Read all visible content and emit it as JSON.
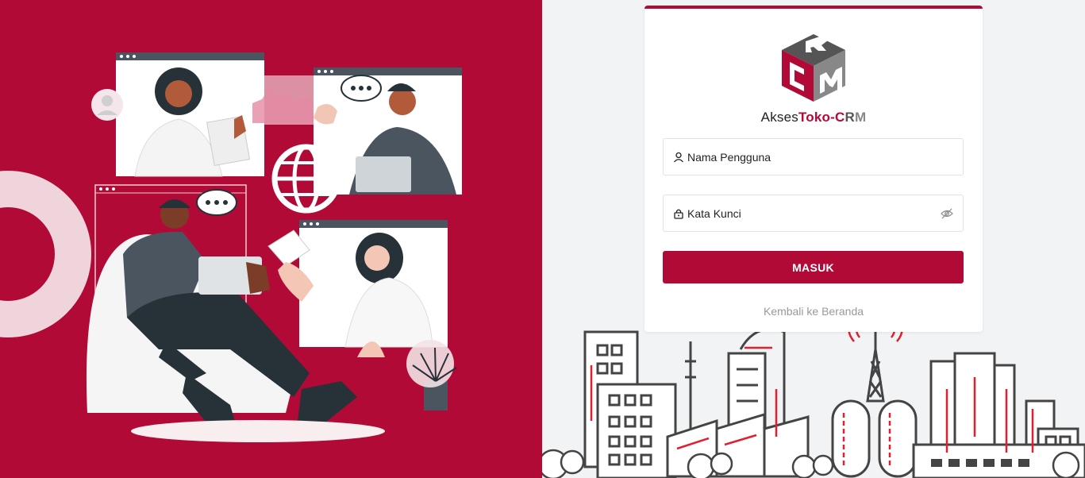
{
  "brand": {
    "prefix": "Akses",
    "toko": "Toko-",
    "c": "C",
    "r": "R",
    "m": "M"
  },
  "form": {
    "username_placeholder": "Nama Pengguna",
    "password_placeholder": "Kata Kunci",
    "submit_label": "MASUK",
    "back_link": "Kembali ke Beranda"
  },
  "icons": {
    "user": "user-icon",
    "lock": "lock-icon",
    "eye": "eye-slash-icon"
  },
  "colors": {
    "brand": "#b20a37",
    "background": "#f2f3f5"
  }
}
